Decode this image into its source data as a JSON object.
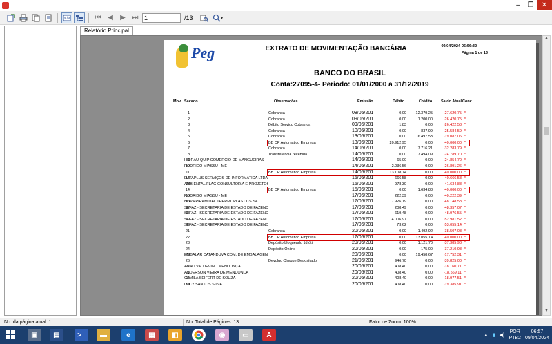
{
  "window": {
    "minimize": "–",
    "restore": "❐",
    "close": "✕"
  },
  "toolbar": {
    "current_page": "1",
    "total_pages": "/13",
    "zoom_icon": "🔍",
    "zoom_arrow": "▾"
  },
  "tab": {
    "label": "Relatório Principal"
  },
  "report": {
    "title": "EXTRATO DE MOVIMENTAÇÃO BANCÁRIA",
    "date": "09/04/2024",
    "time": "06:56:32",
    "page": "Página 1 de 13",
    "bank": "BANCO DO BRASIL",
    "account": "Conta:27095-4- Periodo: 01/01/2000 a 31/12/2019",
    "logo_text": "Peg",
    "headers": {
      "mov": "Mov.",
      "sacado": "Sacado",
      "obs": "Observações",
      "emissao": "Emissão",
      "debito": "Débito",
      "credito": "Crédito",
      "saldo": "Saldo Atual",
      "conc": "Conc."
    },
    "rows": [
      {
        "mov": "1",
        "sacado": "",
        "obs": "Cobrança",
        "emissao": "08/05/201",
        "debito": "0,00",
        "credito": "12.379,25",
        "saldo": "-27.620,75",
        "conc": "*"
      },
      {
        "mov": "2",
        "sacado": "",
        "obs": "Cobrança",
        "emissao": "09/05/201",
        "debito": "0,00",
        "credito": "1.200,00",
        "saldo": "-26.420,75",
        "conc": "*"
      },
      {
        "mov": "3",
        "sacado": "",
        "obs": "Débito Serviço Cobrança",
        "emissao": "09/05/201",
        "debito": "1,83",
        "credito": "0,00",
        "saldo": "-26.422,58",
        "conc": "*"
      },
      {
        "mov": "4",
        "sacado": "",
        "obs": "Cobrança",
        "emissao": "10/05/201",
        "debito": "0,00",
        "credito": "837,99",
        "saldo": "-25.584,59",
        "conc": "*"
      },
      {
        "mov": "5",
        "sacado": "",
        "obs": "Cobrança",
        "emissao": "13/05/201",
        "debito": "0,00",
        "credito": "6.497,53",
        "saldo": "-19.087,06",
        "conc": "*"
      },
      {
        "mov": "6",
        "sacado": "",
        "obs": "BB CP Automatico Empresa",
        "emissao": "13/05/201",
        "debito": "20.912,95",
        "credito": "0,00",
        "saldo": "-40.000,00",
        "conc": "*",
        "hl": true
      },
      {
        "mov": "7",
        "sacado": "",
        "obs": "Cobrança",
        "emissao": "14/05/201",
        "debito": "0,00",
        "credito": "7.716,21",
        "saldo": "-32.283,79",
        "conc": "*"
      },
      {
        "mov": "8",
        "sacado": "",
        "obs": "Transferência recebida",
        "emissao": "14/05/201",
        "debito": "0,00",
        "credito": "7.494,09",
        "saldo": "-24.789,70",
        "conc": "*"
      },
      {
        "mov": "9",
        "sacado": "HIDRAU-QUIP COMERCIO DE MANGUEIRAS",
        "obs": "",
        "emissao": "14/05/201",
        "debito": "65,00",
        "credito": "0,00",
        "saldo": "-24.854,70",
        "conc": "*"
      },
      {
        "mov": "10",
        "sacado": "RODRIGO MIASSU - ME",
        "obs": "",
        "emissao": "14/05/201",
        "debito": "2.036,56",
        "credito": "0,00",
        "saldo": "-26.891,26",
        "conc": "*"
      },
      {
        "mov": "11",
        "sacado": "",
        "obs": "BB CP Automatico Empresa",
        "emissao": "14/05/201",
        "debito": "13.108,74",
        "credito": "0,00",
        "saldo": "-40.000,00",
        "conc": "*",
        "hl": true
      },
      {
        "mov": "12",
        "sacado": "DATAPLUS SERVIÇOS DE INFORMATICA LTDA",
        "obs": "",
        "emissao": "15/05/201",
        "debito": "666,58",
        "credito": "0,00",
        "saldo": "-40.666,58",
        "conc": "*"
      },
      {
        "mov": "13",
        "sacado": "AMBIENTAL FLAG CONSULTORIA E PROJETOS",
        "obs": "",
        "emissao": "15/05/201",
        "debito": "978,30",
        "credito": "0,00",
        "saldo": "-41.634,88",
        "conc": "*"
      },
      {
        "mov": "14",
        "sacado": "",
        "obs": "BB CP Automatico Empresa",
        "emissao": "15/05/201",
        "debito": "0,00",
        "credito": "1.634,88",
        "saldo": "-40.000,00",
        "conc": "*",
        "hl": true
      },
      {
        "mov": "15",
        "sacado": "RODRIGO MIASSU - ME",
        "obs": "",
        "emissao": "17/05/201",
        "debito": "222,39",
        "credito": "0,00",
        "saldo": "-40.222,39",
        "conc": "*"
      },
      {
        "mov": "16",
        "sacado": "NOVA PIRAMIDAL THERMOPLASTICS SA",
        "obs": "",
        "emissao": "17/05/201",
        "debito": "7.926,19",
        "credito": "0,00",
        "saldo": "-48.148,58",
        "conc": "*"
      },
      {
        "mov": "17",
        "sacado": "SEFAZ - SECRETARIA DE ESTADO DE FAZENDA",
        "obs": "",
        "emissao": "17/05/201",
        "debito": "208,49",
        "credito": "0,00",
        "saldo": "-48.357,07",
        "conc": "*"
      },
      {
        "mov": "18",
        "sacado": "SEFAZ - SECRETARIA DE ESTADO DE FAZENDA",
        "obs": "",
        "emissao": "17/05/201",
        "debito": "619,48",
        "credito": "0,00",
        "saldo": "-48.976,55",
        "conc": "*"
      },
      {
        "mov": "19",
        "sacado": "SEFAZ - SECRETARIA DE ESTADO DE FAZENDA",
        "obs": "",
        "emissao": "17/05/201",
        "debito": "4.006,97",
        "credito": "0,00",
        "saldo": "-52.981,52",
        "conc": "*"
      },
      {
        "mov": "20",
        "sacado": "SEFAZ - SECRETARIA DE ESTADO DE FAZENDA",
        "obs": "",
        "emissao": "17/05/201",
        "debito": "73,62",
        "credito": "0,00",
        "saldo": "-53.055,14",
        "conc": "*"
      },
      {
        "mov": "21",
        "sacado": "",
        "obs": "Cobrança",
        "emissao": "20/05/201",
        "debito": "0,00",
        "credito": "1.492,92",
        "saldo": "-38.507,08",
        "conc": "*"
      },
      {
        "mov": "22",
        "sacado": "",
        "obs": "BB CP Automatico Empresa",
        "emissao": "17/05/201",
        "debito": "0,00",
        "credito": "13.055,14",
        "saldo": "-40.000,00",
        "conc": "*",
        "hl": true
      },
      {
        "mov": "23",
        "sacado": "",
        "obs": "Depósito bloqueado 1d útil",
        "emissao": "20/05/201",
        "debito": "0,00",
        "credito": "1.121,70",
        "saldo": "-37.385,98",
        "conc": "*"
      },
      {
        "mov": "24",
        "sacado": "",
        "obs": "Depósito Online",
        "emissao": "20/05/201",
        "debito": "0,00",
        "credito": "175,00",
        "saldo": "-37.210,98",
        "conc": "*"
      },
      {
        "mov": "25",
        "sacado": "EMBALAR CATANDUVA COM. DE EMBALAGENS",
        "obs": "",
        "emissao": "20/05/201",
        "debito": "0,00",
        "credito": "19.458,67",
        "saldo": "-17.752,31",
        "conc": "*"
      },
      {
        "mov": "26",
        "sacado": "",
        "obs": "Devoluç Cheque Depositado",
        "emissao": "21/05/201",
        "debito": "946,70",
        "credito": "0,00",
        "saldo": "-39.825,00",
        "conc": "*"
      },
      {
        "mov": "27",
        "sacado": "ADAO VALDEVINO MENDONÇA",
        "obs": "",
        "emissao": "20/05/201",
        "debito": "408,40",
        "credito": "0,00",
        "saldo": "-18.160,71",
        "conc": "*"
      },
      {
        "mov": "28",
        "sacado": "ANDERSON VIEIRA DE MENDONÇA",
        "obs": "",
        "emissao": "20/05/201",
        "debito": "408,40",
        "credito": "0,00",
        "saldo": "-18.569,11",
        "conc": "*"
      },
      {
        "mov": "29",
        "sacado": "CAMILA SEIFERT DE SOUZA",
        "obs": "",
        "emissao": "20/05/201",
        "debito": "408,40",
        "credito": "0,00",
        "saldo": "-18.977,51",
        "conc": "*"
      },
      {
        "mov": "30",
        "sacado": "LUCY SANTOS SILVA",
        "obs": "",
        "emissao": "20/05/201",
        "debito": "408,40",
        "credito": "0,00",
        "saldo": "-19.385,91",
        "conc": "*"
      }
    ]
  },
  "status": {
    "current_page": "No. da página atual: 1",
    "total_pages": "No. Total de Páginas: 13",
    "zoom": "Fator de Zoom: 100%"
  },
  "tray": {
    "lang1": "POR",
    "lang2": "PTB2",
    "time": "06:57",
    "date": "09/04/2024"
  },
  "colors": {
    "highlight": "#d00000",
    "negative": "#e00000",
    "taskbar": "#1c3f6e"
  }
}
